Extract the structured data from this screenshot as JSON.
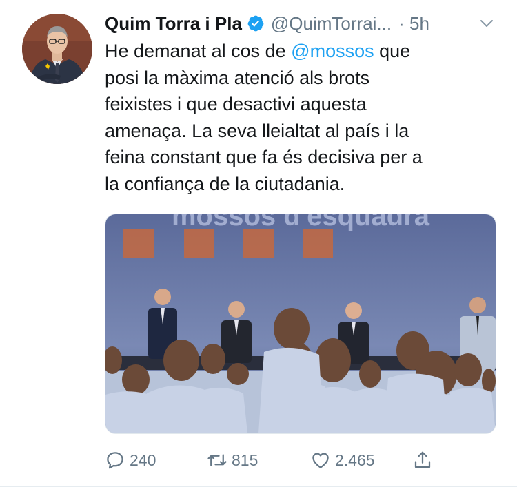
{
  "author": {
    "name": "Quim Torra i Pla",
    "handle": "@QuimTorrai...",
    "time": "· 5h",
    "verified": true,
    "avatar": "avatar-photo"
  },
  "tweet": {
    "lines": [
      {
        "before": "He demanat al cos de ",
        "mention": "@mossos",
        "after": " que"
      },
      {
        "before": "posi la màxima atenció als brots",
        "mention": "",
        "after": ""
      },
      {
        "before": "feixistes i que desactivi aquesta",
        "mention": "",
        "after": ""
      },
      {
        "before": "amenaça. La seva lleialtat al país i la",
        "mention": "",
        "after": ""
      },
      {
        "before": "feina constant que fa és decisiva per a",
        "mention": "",
        "after": ""
      },
      {
        "before": "la confiança de la ciutadania.",
        "mention": "",
        "after": ""
      }
    ]
  },
  "media": {
    "banner_text": "mossos d'esquadra",
    "kind": "photo"
  },
  "actions": {
    "reply_count": "240",
    "retweet_count": "815",
    "like_count": "2.465",
    "icons": [
      "reply-icon",
      "retweet-icon",
      "heart-icon",
      "share-icon"
    ]
  },
  "colors": {
    "accent": "#1da1f2",
    "secondary_text": "#657786",
    "primary_text": "#14171a"
  }
}
